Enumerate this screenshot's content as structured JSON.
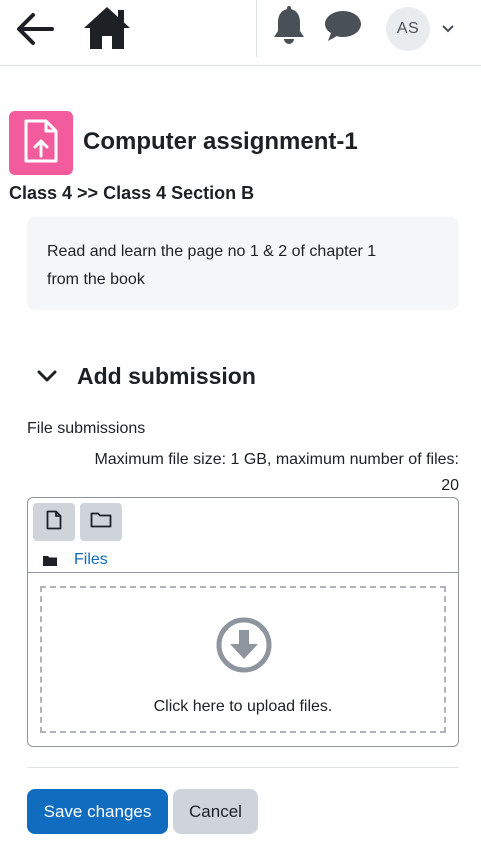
{
  "nav": {
    "user_initials": "AS",
    "icons": [
      "arrow-left-icon",
      "home-icon",
      "bell-icon",
      "chat-bubble-icon",
      "chevron-down-icon"
    ]
  },
  "header": {
    "icon": "file-upload-icon",
    "icon_color": "#f25c9d",
    "title": "Computer assignment-1",
    "breadcrumb": "Class 4 >> Class 4 Section B"
  },
  "intro": {
    "line1": "Read and learn the page no 1 & 2 of chapter 1",
    "line2": "from the book"
  },
  "section": {
    "title": "Add submission"
  },
  "file_submission": {
    "label": "File submissions",
    "limits_line1": "Maximum file size: 1 GB, maximum number of files:",
    "limits_line2": "20",
    "path_label": "Files",
    "drop_text": "Click here to upload files."
  },
  "actions": {
    "save_label": "Save changes",
    "cancel_label": "Cancel"
  },
  "colors": {
    "primary": "#0f6cbf",
    "link": "#0f6cbf",
    "secondary_button": "#ced4da",
    "intro_background": "#f5f6f8"
  }
}
